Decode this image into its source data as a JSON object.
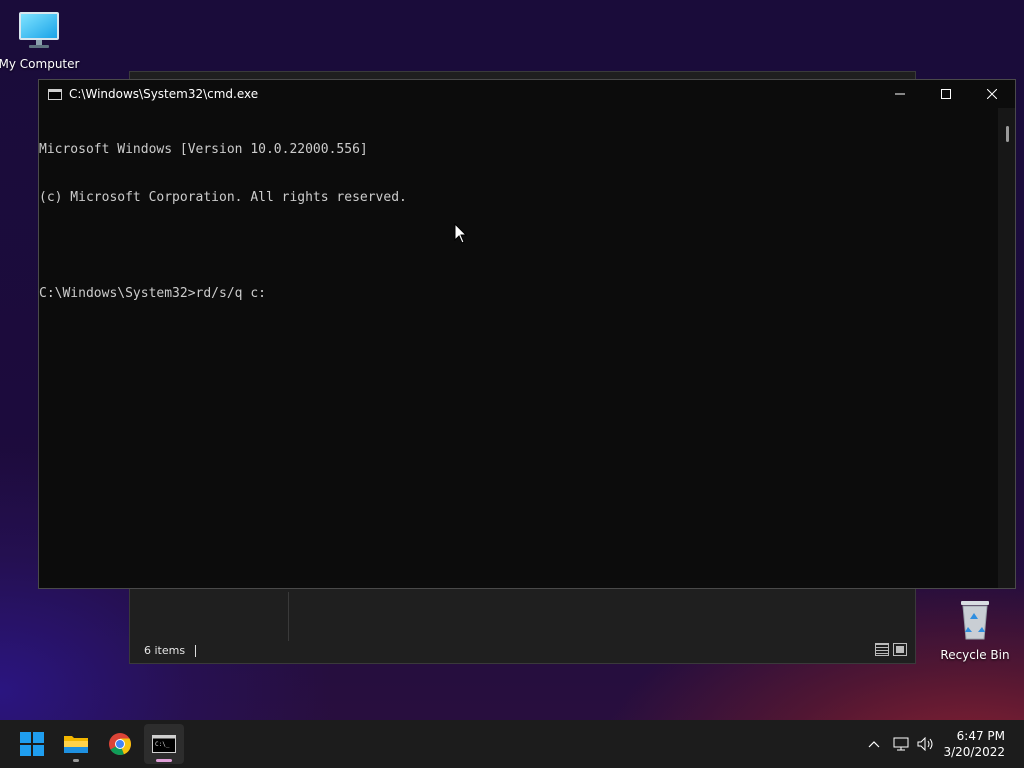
{
  "desktop": {
    "icons": [
      {
        "label": "My Computer",
        "icon": "monitor-icon"
      },
      {
        "label": "Recycle Bin",
        "icon": "recycle-bin-icon"
      }
    ]
  },
  "explorer": {
    "status_items": "6 items"
  },
  "cmd": {
    "title": "C:\\Windows\\System32\\cmd.exe",
    "lines": [
      "Microsoft Windows [Version 10.0.22000.556]",
      "(c) Microsoft Corporation. All rights reserved.",
      "",
      "C:\\Windows\\System32>rd/s/q c:"
    ],
    "controls": [
      "minimize-icon",
      "maximize-icon",
      "close-icon"
    ]
  },
  "taskbar": {
    "apps": [
      {
        "name": "Start",
        "icon": "windows-logo-icon"
      },
      {
        "name": "File Explorer",
        "icon": "folder-icon"
      },
      {
        "name": "Google Chrome",
        "icon": "chrome-icon"
      },
      {
        "name": "Command Prompt",
        "icon": "cmd-icon",
        "active": true
      }
    ],
    "tray_icons": [
      "chevron-up-icon",
      "network-icon",
      "volume-icon"
    ],
    "time": "6:47 PM",
    "date": "3/20/2022"
  },
  "colors": {
    "console_text": "#cccccc",
    "console_bg": "#0c0c0c",
    "taskbar_bg": "#1c1c1c",
    "start_blue": "#1f9ef0"
  }
}
